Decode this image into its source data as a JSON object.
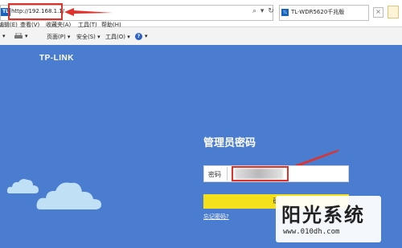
{
  "browser": {
    "url": "http://192.168.1.1/",
    "address_tools": "⌕ ▾ ↻ ✕",
    "tab": {
      "icon": "TL",
      "title": "TL-WDR5620千兆版",
      "close_glyph": "×"
    },
    "menu": [
      "编辑(E)",
      "查看(V)",
      "收藏夹(A)",
      "工具(T)",
      "帮助(H)"
    ],
    "commands": {
      "arrow": "▾",
      "print": "▾",
      "page": "页面(P) ▾",
      "safety": "安全(S) ▾",
      "tools": "工具(O) ▾",
      "help": "?",
      "help_arrow": "▾"
    },
    "ie_icon": "TL"
  },
  "page": {
    "logo": "TP-LINK",
    "title": "管理员密码",
    "password": {
      "label": "密码"
    },
    "confirm_label": "确",
    "forgot_label": "忘记密码?"
  },
  "watermark": {
    "title": "阳光系统",
    "url": "www.010dh.com"
  },
  "colors": {
    "page_bg": "#4a7ccf",
    "button": "#f5e01c",
    "annotation_red": "#e0312b"
  },
  "icons": [
    "ie-icon",
    "search-icon",
    "refresh-icon",
    "close-icon",
    "tab-favicon",
    "new-tab-icon",
    "print-icon",
    "help-icon",
    "cloud-icon",
    "arrow-annotation-icon"
  ]
}
